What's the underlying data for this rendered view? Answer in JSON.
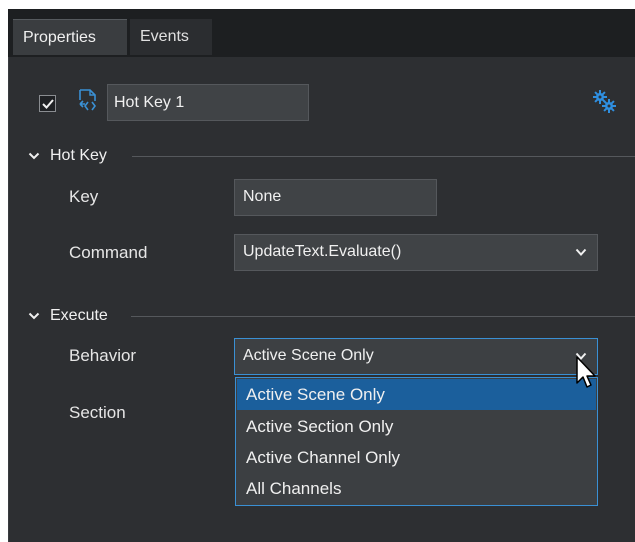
{
  "tabs": [
    {
      "label": "Properties",
      "active": true
    },
    {
      "label": "Events",
      "active": false
    }
  ],
  "header": {
    "enabled_checked": true,
    "name_value": "Hot Key 1"
  },
  "hotkey_section": {
    "title": "Hot Key",
    "expanded": true,
    "key_label": "Key",
    "key_value": "None",
    "command_label": "Command",
    "command_value": "UpdateText.Evaluate()"
  },
  "execute_section": {
    "title": "Execute",
    "expanded": true,
    "behavior_label": "Behavior",
    "behavior_value": "Active Scene Only",
    "section_label": "Section",
    "behavior_options": [
      {
        "label": "Active Scene Only",
        "selected": true
      },
      {
        "label": "Active Section Only",
        "selected": false
      },
      {
        "label": "Active Channel Only",
        "selected": false
      },
      {
        "label": "All Channels",
        "selected": false
      }
    ]
  },
  "colors": {
    "panel_bg": "#2d2f32",
    "field_bg": "#404346",
    "accent": "#3a90d4",
    "selection": "#1b5f9c"
  },
  "icons": [
    "checkmark-icon",
    "hotkey-icon",
    "gear-icon",
    "chevron-down-icon",
    "mouse-cursor-icon"
  ]
}
